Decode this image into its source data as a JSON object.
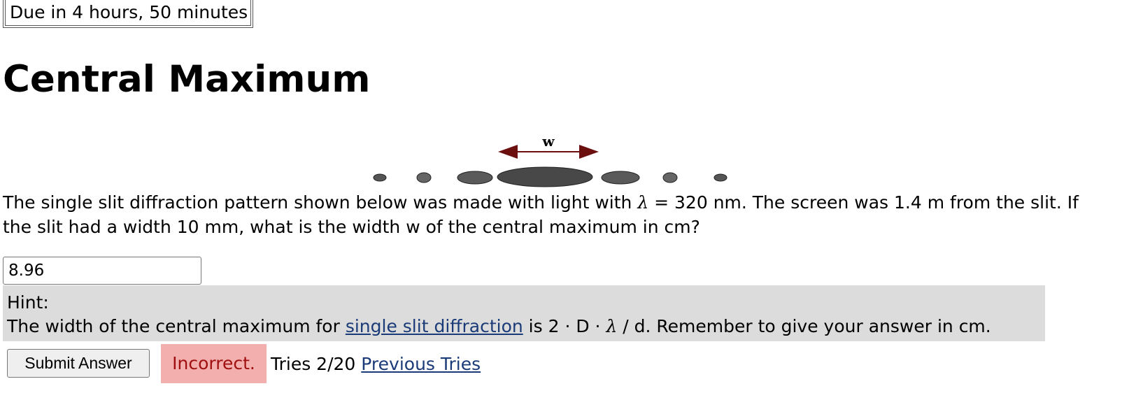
{
  "due": {
    "text": "Due in 4 hours, 50 minutes"
  },
  "title": "Central Maximum",
  "figure": {
    "width_label": "w"
  },
  "question": {
    "part1": "The single slit diffraction pattern shown below was made with light with",
    "lambda_symbol": "λ",
    "part2": " = 320 nm. The screen was 1.4 m from the slit. If the slit had a width 10 mm, what is the width w of the central maximum in cm?"
  },
  "answer": {
    "value": "8.96",
    "placeholder": ""
  },
  "hint": {
    "heading": "Hint:",
    "text_before": "The width of the central maximum for ",
    "link_text": "single slit diffraction",
    "text_middle": " is 2 · D · ",
    "lambda_symbol": "λ",
    "text_after": " / d. Remember to give your answer in cm."
  },
  "submit": {
    "label": "Submit Answer"
  },
  "result": {
    "status": "Incorrect.",
    "tries": "Tries 2/20",
    "previous_tries_link": "Previous Tries"
  },
  "colors": {
    "status_bg": "#f3aeae",
    "status_text": "#a01010",
    "hint_bg": "#dcdcdc",
    "link": "#1a3b78",
    "arrow": "#6b0f0f",
    "fringe": "#4a4a4a",
    "fringe_light": "#6e6e6e"
  }
}
